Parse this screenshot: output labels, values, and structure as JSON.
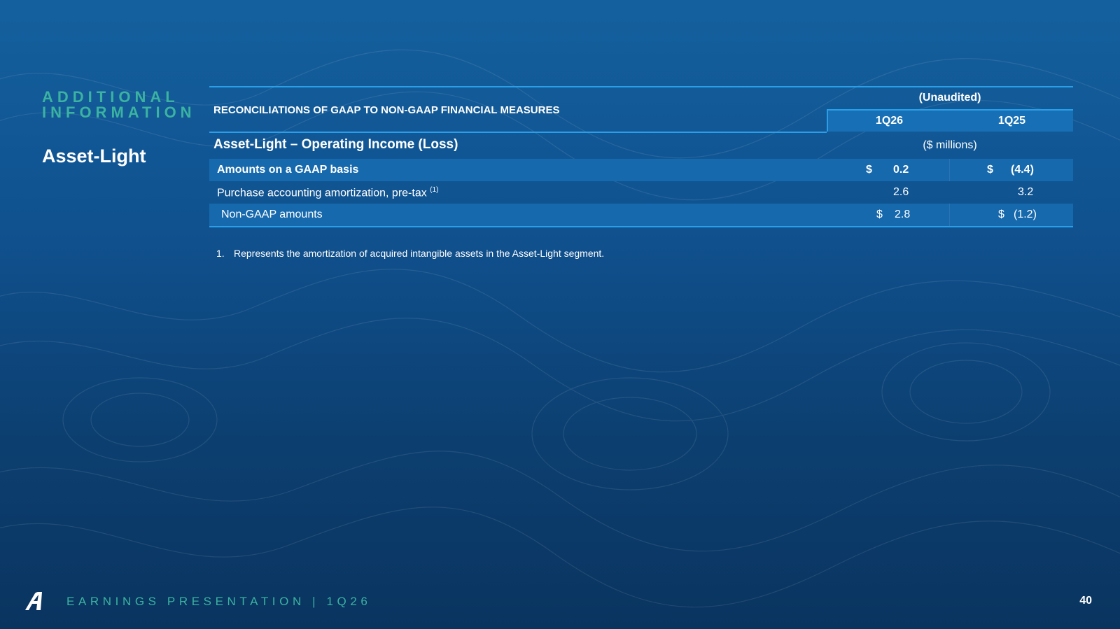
{
  "sidebar": {
    "label_line1": "ADDITIONAL",
    "label_line2": "INFORMATION",
    "heading": "Asset-Light"
  },
  "table": {
    "title": "RECONCILIATIONS OF GAAP TO NON-GAAP FINANCIAL MEASURES",
    "unaudited": "(Unaudited)",
    "columns": [
      "1Q26",
      "1Q25"
    ],
    "section_title": "Asset-Light – Operating Income (Loss)",
    "units": "($ millions)",
    "rows": [
      {
        "label": "Amounts on a GAAP basis",
        "footnote_ref": "",
        "values": [
          {
            "currency": "$",
            "amount": "0.2"
          },
          {
            "currency": "$",
            "amount": "(4.4)"
          }
        ]
      },
      {
        "label": "Purchase accounting amortization, pre-tax",
        "footnote_ref": "(1)",
        "values": [
          {
            "currency": "",
            "amount": "2.6"
          },
          {
            "currency": "",
            "amount": "3.2"
          }
        ]
      },
      {
        "label": "Non-GAAP amounts",
        "footnote_ref": "",
        "values": [
          {
            "currency": "$",
            "amount": "2.8"
          },
          {
            "currency": "$",
            "amount": "(1.2)"
          }
        ]
      }
    ]
  },
  "footnotes": [
    {
      "num": "1.",
      "text": "Represents the amortization of acquired intangible assets in the Asset-Light segment."
    }
  ],
  "footer": {
    "text": "EARNINGS PRESENTATION  |  1Q26",
    "page_number": "40",
    "logo_icon": "company-logo-icon"
  },
  "colors": {
    "accent_teal": "#3bb3a0",
    "rule_blue": "#2a9ee6",
    "row_shade": "#1669ad",
    "background": "#105290"
  }
}
